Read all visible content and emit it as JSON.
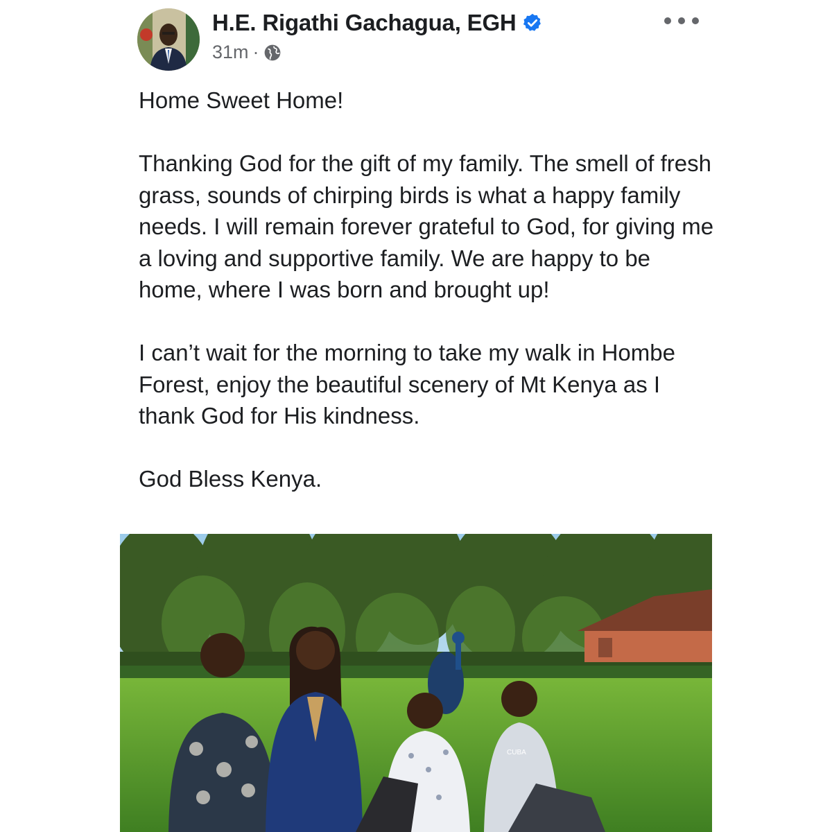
{
  "post": {
    "author": "H.E. Rigathi Gachagua, EGH",
    "time": "31m",
    "separator": "·",
    "verified_icon": "verified-badge-icon",
    "audience_icon": "globe-icon",
    "more_icon": "more-options-icon",
    "paragraphs": [
      "Home Sweet Home!",
      "Thanking God for the gift of my family. The smell of fresh grass, sounds  of chirping birds is what a happy family needs. I will remain forever grateful to God, for giving me a loving and supportive family. We are happy to be home, where I was born and brought up!",
      "I can’t wait for the morning to take my walk in Hombe Forest, enjoy the beautiful scenery of Mt Kenya as I  thank God for His kindness.",
      "God Bless Kenya."
    ],
    "photo_shirt_text": "CUBA"
  },
  "colors": {
    "text": "#1c1e21",
    "secondary_text": "#65676b",
    "verified_blue": "#1877f2",
    "grass": "#5a9a2c",
    "sky": "#8fc3e8"
  }
}
